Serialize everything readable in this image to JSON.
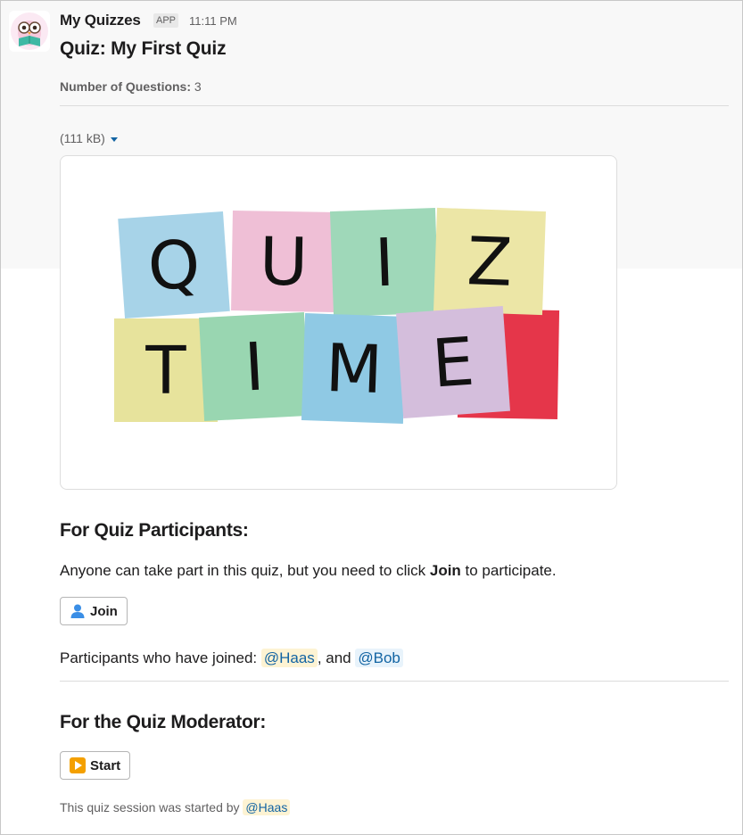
{
  "message": {
    "sender": "My Quizzes",
    "badge": "APP",
    "time": "11:11 PM"
  },
  "quiz": {
    "title": "Quiz: My First Quiz",
    "num_questions_label": "Number of Questions:",
    "num_questions_value": "3"
  },
  "attachment": {
    "size_label": "(111 kB)",
    "notes": [
      {
        "letter": "Q",
        "color": "#a7d3e8"
      },
      {
        "letter": "U",
        "color": "#efbfd6"
      },
      {
        "letter": "I",
        "color": "#9fd8b9"
      },
      {
        "letter": "Z",
        "color": "#ece6a6"
      },
      {
        "letter": "T",
        "color": "#e7e39c"
      },
      {
        "letter": "I",
        "color": "#99d6b1"
      },
      {
        "letter": "M",
        "color": "#8fc9e4"
      },
      {
        "letter": "E",
        "color": "#d4bedc"
      },
      {
        "letter": "!",
        "color": "#e5364a"
      }
    ]
  },
  "participants": {
    "heading": "For Quiz Participants:",
    "text_before": "Anyone can take part in this quiz, but you need to click ",
    "text_bold": "Join",
    "text_after": " to participate.",
    "join_label": "Join",
    "joined_label": "Participants who have joined: ",
    "joined_sep": ", and ",
    "joined": [
      "@Haas",
      "@Bob"
    ]
  },
  "moderator": {
    "heading": "For the Quiz Moderator:",
    "start_label": "Start",
    "started_text": "This quiz session was started by ",
    "started_by": "@Haas"
  },
  "icons": {
    "avatar": "owl-reading-icon",
    "dropdown": "caret-down-icon",
    "join": "person-icon",
    "start": "play-button-icon"
  },
  "colors": {
    "link": "#1264a3",
    "mention_highlight": "#fdf3d3",
    "mention_default": "#e8f3fb",
    "start_icon": "#f4a000"
  }
}
